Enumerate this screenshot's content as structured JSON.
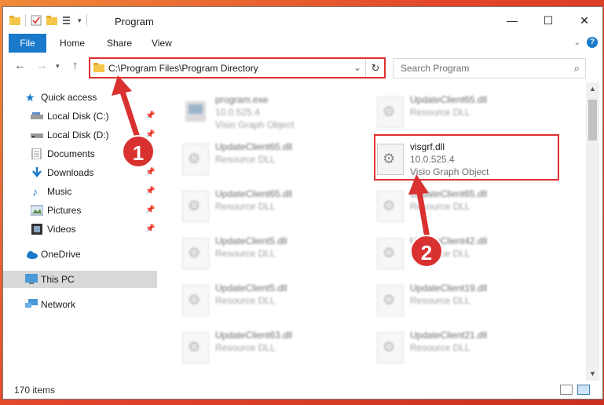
{
  "window": {
    "title": "Program"
  },
  "ribbon": {
    "tabs": [
      "File",
      "Home",
      "Share",
      "View"
    ]
  },
  "address_bar": {
    "path": "C:\\Program Files\\Program Directory"
  },
  "search": {
    "placeholder": "Search Program"
  },
  "sidebar": {
    "quick_access": "Quick access",
    "items": [
      {
        "label": "Local Disk (C:)",
        "icon": "drive-icon",
        "pinned": true
      },
      {
        "label": "Local Disk (D:)",
        "icon": "drive-icon",
        "pinned": true
      },
      {
        "label": "Documents",
        "icon": "documents-icon",
        "pinned": true
      },
      {
        "label": "Downloads",
        "icon": "downloads-icon",
        "pinned": true
      },
      {
        "label": "Music",
        "icon": "music-icon",
        "pinned": true
      },
      {
        "label": "Pictures",
        "icon": "pictures-icon",
        "pinned": true
      },
      {
        "label": "Videos",
        "icon": "videos-icon",
        "pinned": true
      }
    ],
    "onedrive": "OneDrive",
    "this_pc": "This PC",
    "network": "Network"
  },
  "files": [
    {
      "name": "program.exe",
      "line2": "10.0.525.4",
      "line3": "Visio Graph Object",
      "icon": "exe-icon",
      "blurred": true
    },
    {
      "name": "UpdateClient65.dll",
      "line2": "Resource DLL",
      "line3": "",
      "icon": "dll-icon",
      "blurred": true
    },
    {
      "name": "UpdateClient65.dll",
      "line2": "Resource DLL",
      "line3": "",
      "icon": "dll-icon",
      "blurred": true
    },
    {
      "name": "visgrf.dll",
      "line2": "10.0.525.4",
      "line3": "Visio Graph Object",
      "icon": "dll-icon",
      "blurred": false
    },
    {
      "name": "UpdateClient65.dll",
      "line2": "Resource DLL",
      "line3": "",
      "icon": "dll-icon",
      "blurred": true
    },
    {
      "name": "UpdateClient65.dll",
      "line2": "Resource DLL",
      "line3": "",
      "icon": "dll-icon",
      "blurred": true
    },
    {
      "name": "UpdateClient5.dll",
      "line2": "Resource DLL",
      "line3": "",
      "icon": "dll-icon",
      "blurred": true
    },
    {
      "name": "UpdateClient42.dll",
      "line2": "Resource DLL",
      "line3": "",
      "icon": "dll-icon",
      "blurred": true
    },
    {
      "name": "UpdateClient5.dll",
      "line2": "Resource DLL",
      "line3": "",
      "icon": "dll-icon",
      "blurred": true
    },
    {
      "name": "UpdateClient19.dll",
      "line2": "Resource DLL",
      "line3": "",
      "icon": "dll-icon",
      "blurred": true
    },
    {
      "name": "UpdateClient63.dll",
      "line2": "Resource DLL",
      "line3": "",
      "icon": "dll-icon",
      "blurred": true
    },
    {
      "name": "UpdateClient21.dll",
      "line2": "Resource DLL",
      "line3": "",
      "icon": "dll-icon",
      "blurred": true
    }
  ],
  "status": {
    "item_count": "170 items"
  },
  "callouts": {
    "one": "1",
    "two": "2"
  },
  "colors": {
    "accent": "#1979ca",
    "highlight_box": "#e03030",
    "callout": "#d93030"
  }
}
